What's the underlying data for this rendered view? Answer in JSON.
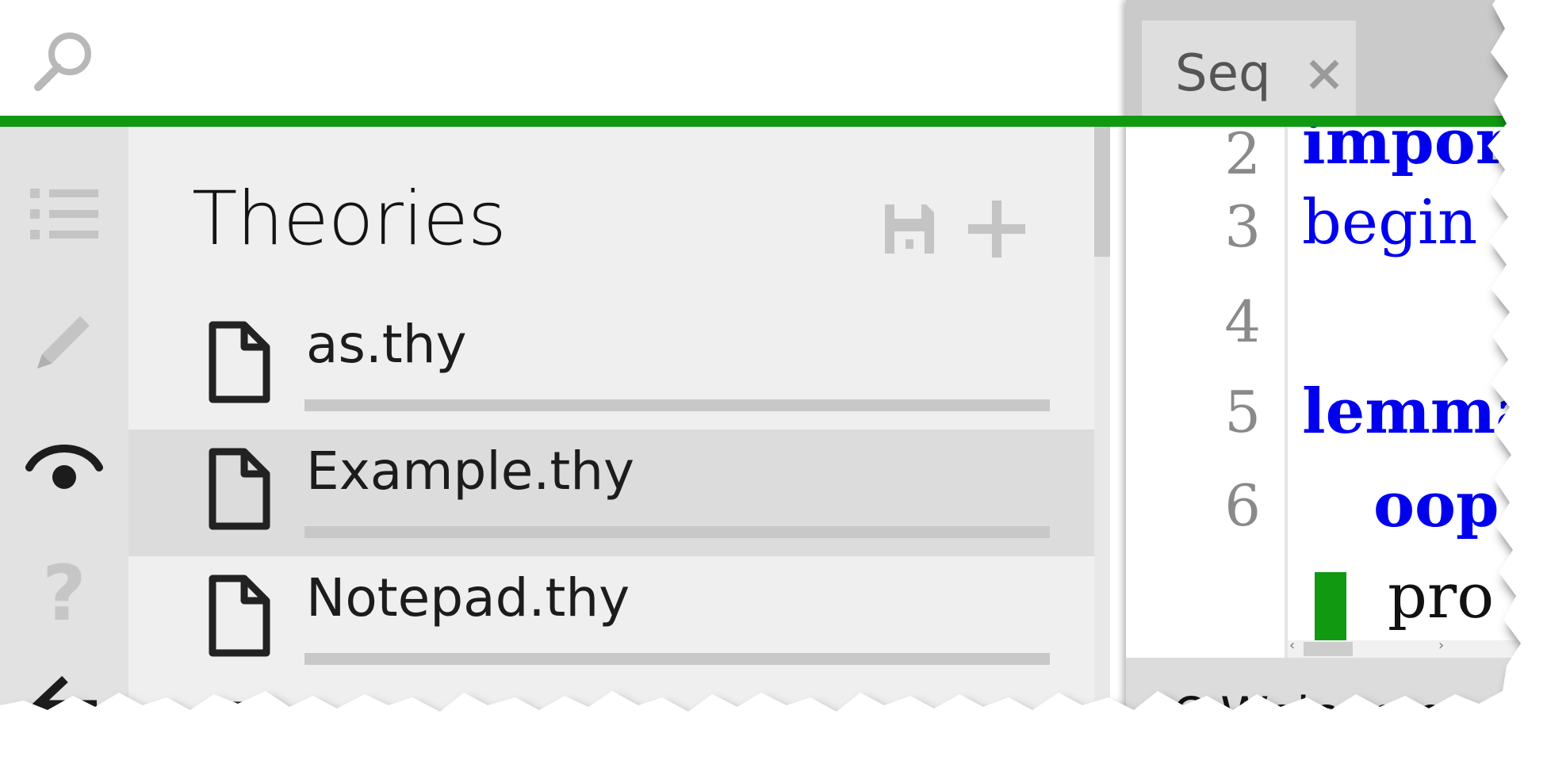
{
  "colors": {
    "accent": "#119911",
    "keyword": "#0000ee",
    "icon_muted": "#c4c4c4",
    "icon_dark": "#222222"
  },
  "search": {
    "icon": "search-icon"
  },
  "rail": {
    "items": [
      {
        "icon": "list-icon",
        "state": "inactive"
      },
      {
        "icon": "pencil-icon",
        "state": "inactive"
      },
      {
        "icon": "eye-icon",
        "state": "active"
      },
      {
        "icon": "help-icon",
        "label": "?",
        "state": "inactive"
      },
      {
        "icon": "back-arrow-icon",
        "state": "active"
      }
    ]
  },
  "theories": {
    "title": "Theories",
    "actions": [
      {
        "icon": "save-icon"
      },
      {
        "icon": "plus-icon"
      }
    ],
    "files": [
      {
        "name": "as.thy",
        "selected": false
      },
      {
        "name": "Example.thy",
        "selected": true
      },
      {
        "name": "Notepad.thy",
        "selected": false
      }
    ]
  },
  "editor": {
    "tab": {
      "label": "Seq",
      "close_icon": "close-icon"
    },
    "line_numbers": [
      "2",
      "3",
      "4",
      "5",
      "6"
    ],
    "code": {
      "line2": "import",
      "line3": "begin",
      "line5": "lemma",
      "line6": "oop",
      "line7": "pro"
    },
    "status": "Q Welcome"
  }
}
